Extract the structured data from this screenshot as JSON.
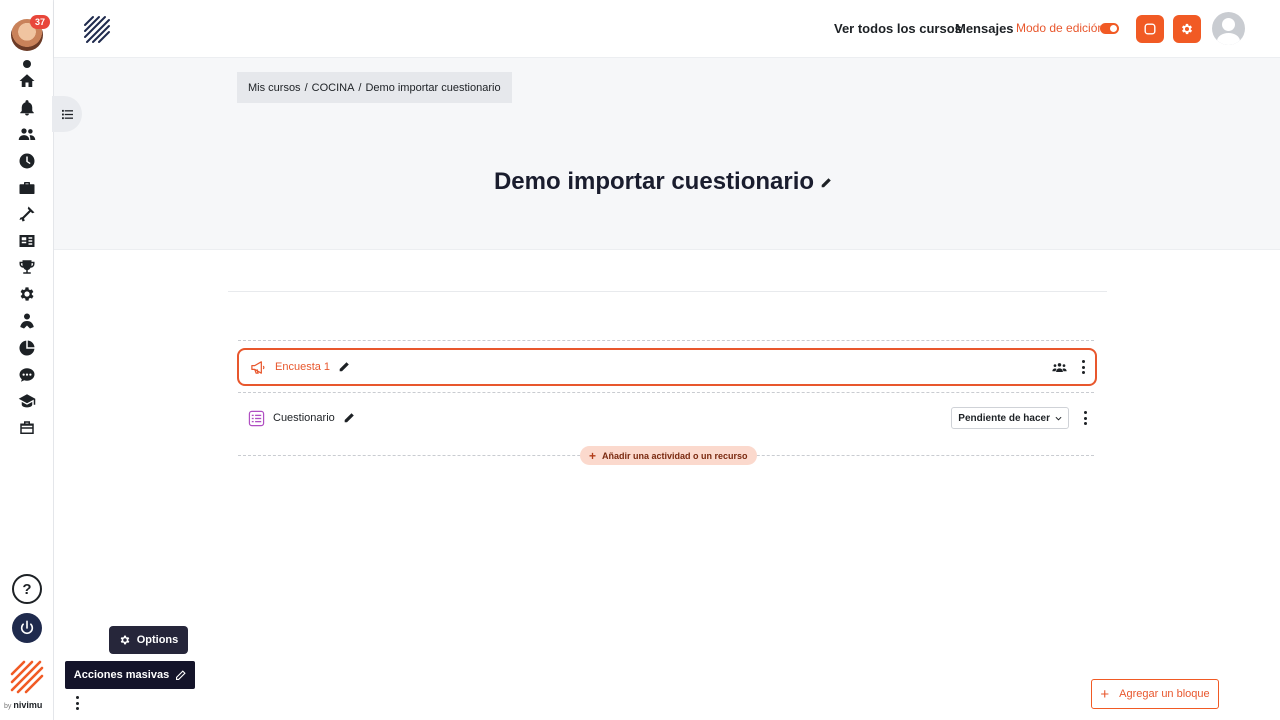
{
  "rail": {
    "notification_count": "37",
    "icons": [
      "home-icon",
      "bell-icon",
      "users-icon",
      "clock-icon",
      "briefcase-icon",
      "tools-icon",
      "contact-card-icon",
      "trophy-icon",
      "gear-icon",
      "handshake-icon",
      "pie-chart-icon",
      "chat-icon",
      "graduation-cap-icon",
      "toolbox-icon"
    ],
    "help_label": "?",
    "byline_by": "by",
    "byline_brand": "nivimu"
  },
  "topbar": {
    "link_all_courses": "Ver todos los cursos",
    "link_messages": "Mensajes",
    "edit_mode_label": "Modo de edición",
    "edit_mode_on": true,
    "accent_color": "#f15a24"
  },
  "breadcrumb": {
    "items": [
      "Mis cursos",
      "COCINA",
      "Demo importar cuestionario"
    ],
    "separator": "/"
  },
  "page": {
    "title": "Demo importar cuestionario"
  },
  "activities": [
    {
      "name": "Encuesta 1",
      "type_icon": "megaphone-icon",
      "highlighted": true,
      "right_icon": "group-mode-icon"
    },
    {
      "name": "Cuestionario",
      "type_icon": "quiz-icon",
      "highlighted": false,
      "status": "Pendiente de hacer"
    }
  ],
  "add_activity_label": "Añadir una actividad o un recurso",
  "bottom": {
    "options_label": "Options",
    "bulk_actions_label": "Acciones masivas",
    "add_block_label": "Agregar un bloque"
  }
}
